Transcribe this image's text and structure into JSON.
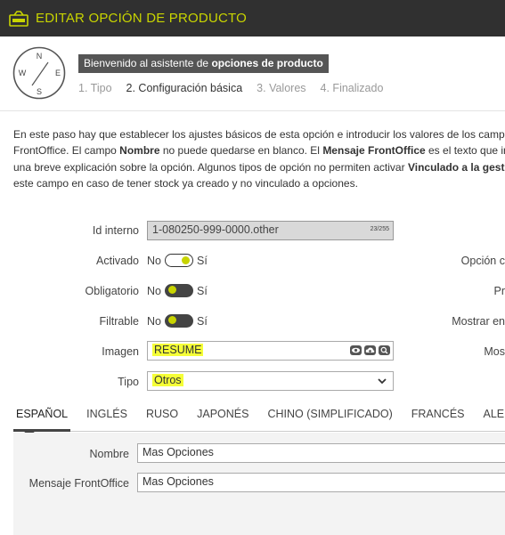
{
  "window": {
    "title": "EDITAR OPCIÓN DE PRODUCTO",
    "icon": "product-option-icon"
  },
  "wizard": {
    "compass_letters": {
      "n": "N",
      "e": "E",
      "s": "S",
      "w": "W"
    },
    "welcome_prefix": "Bienvenido al asistente de ",
    "welcome_bold": "opciones de producto",
    "steps": [
      "1. Tipo",
      "2. Configuración básica",
      "3. Valores",
      "4. Finalizado"
    ],
    "active_step": 1
  },
  "intro": {
    "l1": "En este paso hay que establecer los ajustes básicos de esta opción e introducir los valores de los campos que",
    "l2a": "FrontOffice. El campo ",
    "l2b": "Nombre",
    "l2c": " no puede quedarse en blanco. El ",
    "l2d": "Mensaje FrontOffice",
    "l2e": " es el texto que invita",
    "l3a": "una breve explicación sobre la opción. Algunos tipos de opción no permiten activar ",
    "l3b": "Vinculado a la gestión d",
    "l4": "este campo en caso de tener stock ya creado y no vinculado a opciones."
  },
  "form": {
    "id_label": "Id interno",
    "id_value": "1-080250-999-0000.other",
    "id_counter": "23/255",
    "activado_label": "Activado",
    "obligatorio_label": "Obligatorio",
    "filtrable_label": "Filtrable",
    "no": "No",
    "si": "Sí",
    "toggles": {
      "activado": true,
      "obligatorio": false,
      "filtrable": false
    },
    "imagen_label": "Imagen",
    "imagen_value": "RESUME",
    "tipo_label": "Tipo",
    "tipo_value": "Otros",
    "right_labels": [
      "Opción c",
      "Pr",
      "Mostrar en",
      "Mos"
    ]
  },
  "languages": [
    "ESPAÑOL",
    "INGLÉS",
    "RUSO",
    "JAPONÉS",
    "CHINO (SIMPLIFICADO)",
    "FRANCÉS",
    "ALEMÁN"
  ],
  "lang_form": {
    "nombre_label": "Nombre",
    "nombre_value": "Mas Opciones",
    "mensaje_label": "Mensaje FrontOffice",
    "mensaje_value": "Mas Opciones"
  },
  "colors": {
    "accent": "#c8d400",
    "highlight": "#f5ff37",
    "titlebar": "#303030"
  }
}
